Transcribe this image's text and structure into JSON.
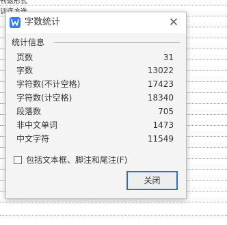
{
  "background_document": {
    "fragments": [
      "刊返形式",
      "训连方迭"
    ]
  },
  "dialog": {
    "title": "字数统计",
    "section_label": "统计信息",
    "stats": [
      {
        "label": "页数",
        "value": "31"
      },
      {
        "label": "字数",
        "value": "13022"
      },
      {
        "label": "字符数(不计空格)",
        "value": "17423"
      },
      {
        "label": "字符数(计空格)",
        "value": "18340"
      },
      {
        "label": "段落数",
        "value": "705"
      },
      {
        "label": "非中文单词",
        "value": "1473"
      },
      {
        "label": "中文字符",
        "value": "11549"
      }
    ],
    "checkbox": {
      "label": "包括文本框、脚注和尾注(F)",
      "checked": false
    },
    "close_button": "关闭",
    "close_icon": "close-icon",
    "app_icon": "wps-writer-icon"
  },
  "colors": {
    "accent": "#2b6fd6",
    "app_icon": "#2f80ed",
    "dialog_background": "#f4f4f4",
    "titlebar_background": "#ffffff"
  }
}
